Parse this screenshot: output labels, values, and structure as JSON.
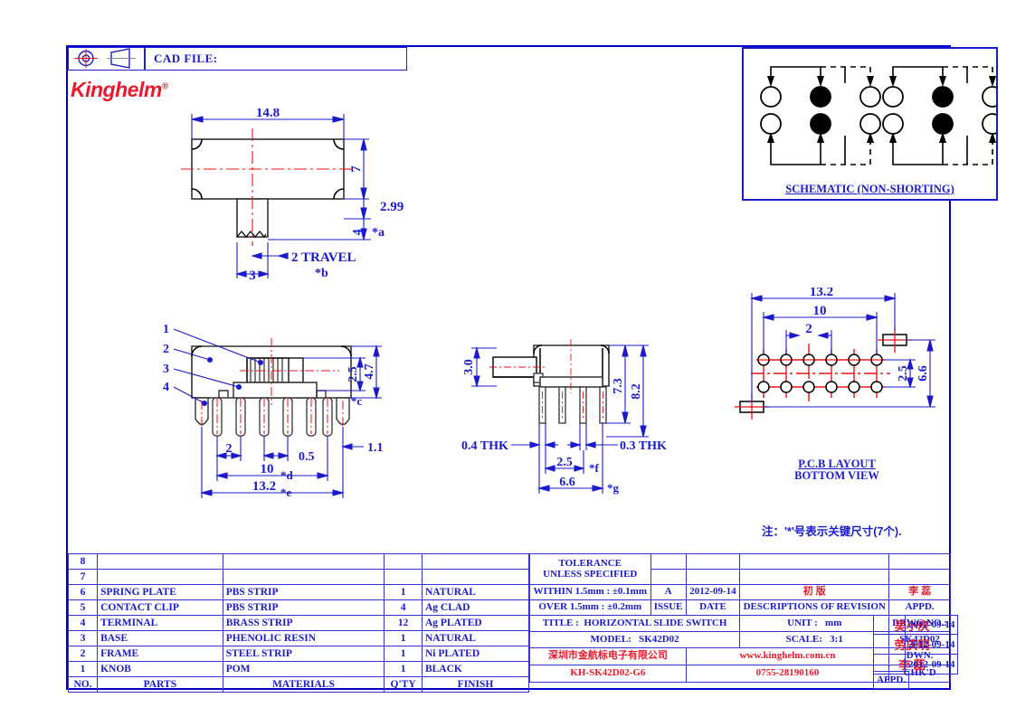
{
  "header": {
    "cad_file_label": "CAD  FILE:",
    "projection_symbol": "first-angle-projection-symbol",
    "logo_text": "Kinghelm",
    "logo_mark": "®"
  },
  "schematic": {
    "caption": "SCHEMATIC  (NON-SHORTING)",
    "groups": 2,
    "pins_per_row": 3,
    "rows": 2
  },
  "views": {
    "top_view": {
      "dims": {
        "width": "14.8",
        "height": "7",
        "offset": "2.99",
        "knob_height": "4",
        "knob_star": "*a",
        "travel": "2  TRAVEL",
        "travel_star": "*b",
        "knob_width": "3"
      }
    },
    "front_view": {
      "callouts": [
        "1",
        "2",
        "3",
        "4"
      ],
      "dims": {
        "pitch": "2",
        "pin_width": "0.5",
        "span_pins": "10",
        "span_pins_star": "*d",
        "overall": "13.2",
        "overall_star": "*e",
        "body_height": "4.7",
        "inner_height": "2.5",
        "inner_star": "*c",
        "edge": "1.1"
      }
    },
    "side_view": {
      "dims": {
        "knob_len": "3.0",
        "pin_len_inner": "7.3",
        "overall_height": "8.2",
        "thk_left": "0.4  THK",
        "thk_right": "0.3  THK",
        "row_pitch": "2.5",
        "row_pitch_star": "*f",
        "depth": "6.6",
        "depth_star": "*g"
      }
    },
    "pcb_layout": {
      "caption_line1": "P.C.B  LAYOUT",
      "caption_line2": "BOTTOM  VIEW",
      "dims": {
        "overall": "13.2",
        "pad_span": "10",
        "pitch": "2",
        "row_pitch": "2.5",
        "depth": "6.6"
      },
      "pads_per_row": 6,
      "rows": 2
    }
  },
  "note": "注：'*'号表示关键尺寸(7个).",
  "parts_table": {
    "headers": [
      "NO.",
      "PARTS",
      "MATERIALS",
      "Q'TY",
      "FINISH"
    ],
    "rows": [
      {
        "no": "8",
        "part": "",
        "material": "",
        "qty": "",
        "finish": ""
      },
      {
        "no": "7",
        "part": "",
        "material": "",
        "qty": "",
        "finish": ""
      },
      {
        "no": "6",
        "part": "SPRING  PLATE",
        "material": "PBS  STRIP",
        "qty": "1",
        "finish": "NATURAL"
      },
      {
        "no": "5",
        "part": "CONTACT  CLIP",
        "material": "PBS  STRIP",
        "qty": "4",
        "finish": "Ag  CLAD"
      },
      {
        "no": "4",
        "part": "TERMINAL",
        "material": "BRASS  STRIP",
        "qty": "12",
        "finish": "Ag  PLATED"
      },
      {
        "no": "3",
        "part": "BASE",
        "material": "PHENOLIC  RESIN",
        "qty": "1",
        "finish": "NATURAL"
      },
      {
        "no": "2",
        "part": "FRAME",
        "material": "STEEL  STRIP",
        "qty": "1",
        "finish": "Ni  PLATED"
      },
      {
        "no": "1",
        "part": "KNOB",
        "material": "POM",
        "qty": "1",
        "finish": "BLACK"
      }
    ]
  },
  "title_block": {
    "tolerance_line1": "TOLERANCE",
    "tolerance_line2": "UNLESS   SPECIFIED",
    "tolerance_within": "WITHIN  1.5mm  :  ±0.1mm",
    "tolerance_over": "OVER  1.5mm  :  ±0.2mm",
    "issue_value": "A",
    "issue_label": "ISSUE",
    "date_value": "2012-09-14",
    "date_label": "DATE",
    "revision_value": "初    版",
    "revision_label": "DESCRIPTIONS  OF  REVISION",
    "appd_header_name": "李 蕊",
    "appd_header_label": "APPD.",
    "title_label": "TITLE :",
    "title_value": "HORIZONTAL  SLIDE  SWITCH",
    "model_label": "MODEL:",
    "model_value": "SK42D02",
    "unit_label": "UNIT :",
    "unit_value": "mm",
    "scale_label": "SCALE:",
    "scale_value": "3:1",
    "drwg_no_label": "DRWG  NO.:",
    "drwg_no_value": "SK42D02",
    "dwn_label": "DWN.",
    "dwn_name": "吴小庆",
    "dwn_date": "2012-09-14",
    "chkd_label": "CHK'D",
    "chkd_name": "劳庆明",
    "chkd_date": "2012-09-14",
    "appd_label": "APPD.",
    "appd_name": "李 蕊",
    "appd_date": "2012-09-14",
    "company_cn": "深圳市金航标电子有限公司",
    "website": "www.kinghelm.com.cn",
    "part_number": "KH-SK42D02-G6",
    "phone": "0755-28190160"
  },
  "colors": {
    "blue": "#1a1acc",
    "red": "#e8192c",
    "centerline": "#ee1111",
    "black": "#000000"
  }
}
